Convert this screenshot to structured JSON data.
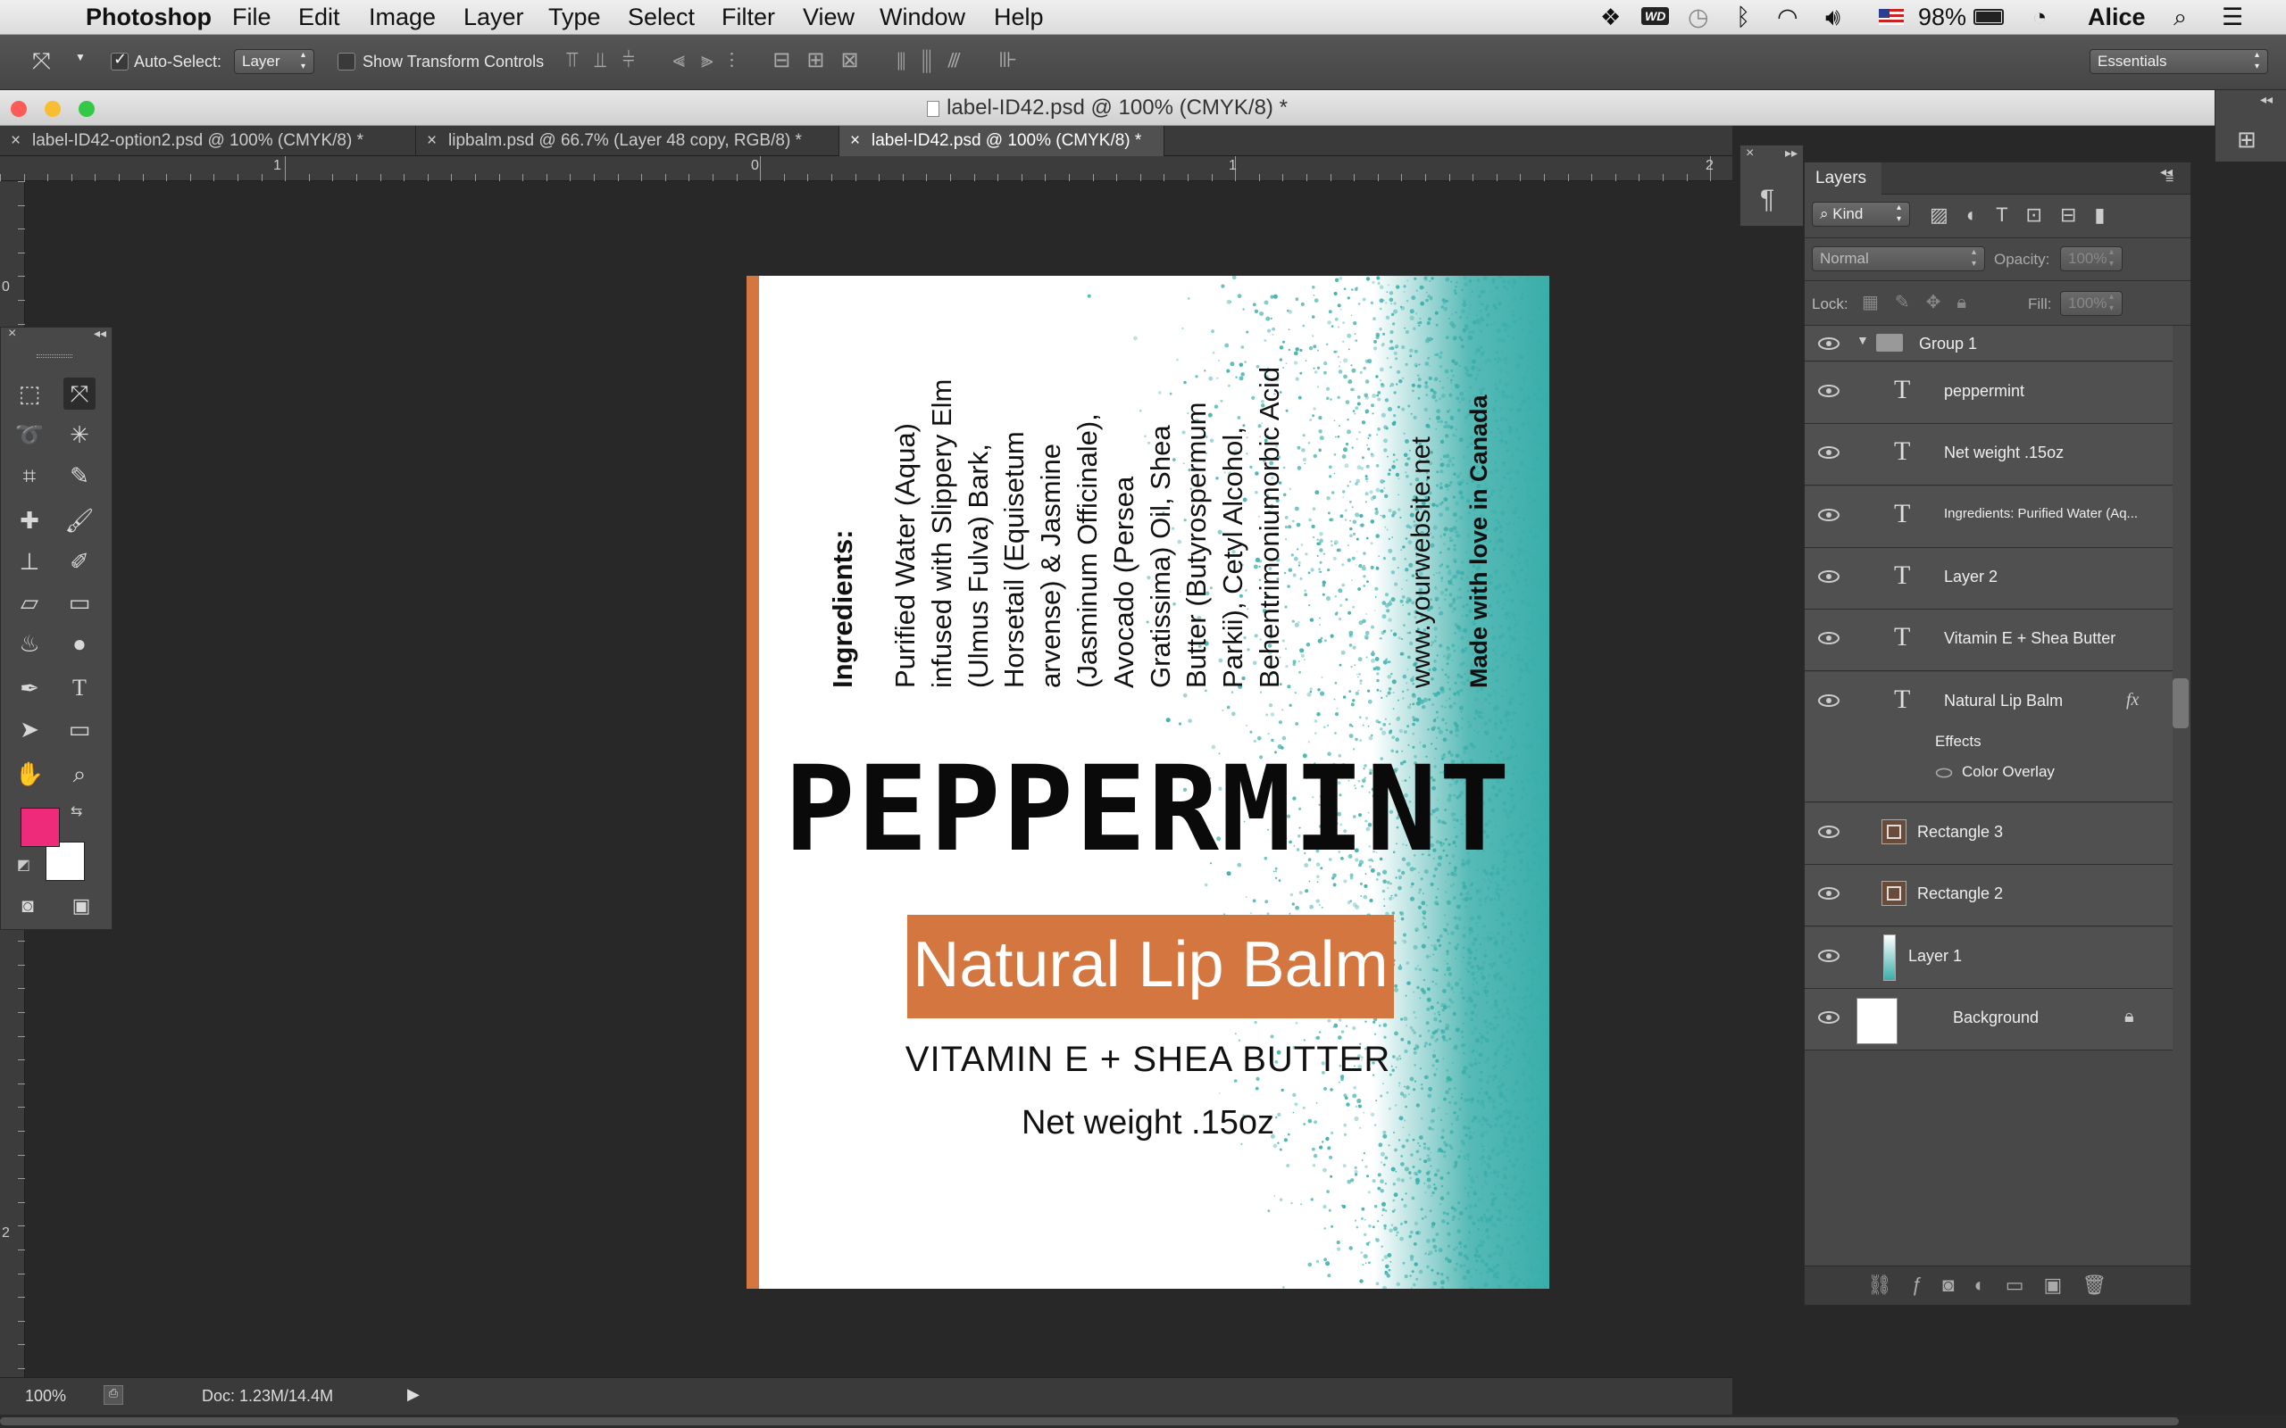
{
  "menubar": {
    "app_name": "Photoshop",
    "items": [
      "File",
      "Edit",
      "Image",
      "Layer",
      "Type",
      "Select",
      "Filter",
      "View",
      "Window",
      "Help"
    ],
    "battery": "98%",
    "user": "Alice",
    "tray_icons": [
      "dropbox-icon",
      "wd-icon",
      "time-machine-icon",
      "bluetooth-icon",
      "wifi-icon",
      "volume-icon",
      "flag-icon",
      "battery-icon",
      "clock-icon",
      "search-icon",
      "list-icon"
    ]
  },
  "options": {
    "auto_select_label": "Auto-Select:",
    "auto_select_value": "Layer",
    "show_transform_label": "Show Transform Controls",
    "workspace": "Essentials"
  },
  "window": {
    "title": "label-ID42.psd @ 100% (CMYK/8) *"
  },
  "tabs": [
    {
      "label": "label-ID42-option2.psd @ 100% (CMYK/8) *",
      "active": false
    },
    {
      "label": "lipbalm.psd @ 66.7% (Layer 48 copy, RGB/8) *",
      "active": false
    },
    {
      "label": "label-ID42.psd @ 100% (CMYK/8) *",
      "active": true
    }
  ],
  "ruler": {
    "h_labels": [
      "1",
      "0",
      "1",
      "2"
    ],
    "v_labels": [
      "0",
      "2"
    ]
  },
  "label": {
    "ingredients_heading": "Ingredients:",
    "ingredients_lines": [
      "Purified Water (Aqua)",
      "infused with Slippery Elm",
      "(Ulmus Fulva) Bark,",
      "Horsetail (Equisetum",
      "arvense) & Jasmine",
      "(Jasminum Officinale),",
      "Avocado (Persea",
      "Gratissima) Oil, Shea",
      "Butter (Butyrospermum",
      "Parkii), Cetyl Alcohol,",
      "Behentrimoniumorbic Acid"
    ],
    "website": "www.yourwebsite.net",
    "made_in": "Made with love in Canada",
    "flavor": "PEPPERMINT",
    "product": "Natural Lip Balm",
    "tagline": "VITAMIN E + SHEA BUTTER",
    "net_weight": "Net weight .15oz",
    "colors": {
      "teal": "#3aaeaa",
      "orange": "#d4763f"
    }
  },
  "layers_panel": {
    "title": "Layers",
    "filter_kind": "Kind",
    "blend_mode": "Normal",
    "opacity_label": "Opacity:",
    "opacity_value": "100%",
    "lock_label": "Lock:",
    "fill_label": "Fill:",
    "fill_value": "100%",
    "group_name": "Group 1",
    "layers": [
      {
        "name": "peppermint",
        "type": "text"
      },
      {
        "name": "Net weight .15oz",
        "type": "text"
      },
      {
        "name": "Ingredients:   Purified Water (Aq...",
        "type": "text"
      },
      {
        "name": "Layer 2",
        "type": "text"
      },
      {
        "name": "Vitamin E + Shea Butter",
        "type": "text"
      },
      {
        "name": "Natural Lip Balm",
        "type": "text",
        "fx": "fx"
      }
    ],
    "effects_label": "Effects",
    "effect_name": "Color Overlay",
    "lower_layers": [
      {
        "name": "Rectangle 3",
        "type": "shape"
      },
      {
        "name": "Rectangle 2",
        "type": "shape"
      },
      {
        "name": "Layer 1",
        "type": "pixel"
      },
      {
        "name": "Background",
        "type": "background"
      }
    ]
  },
  "tools": {
    "foreground": "#ee2b7b",
    "background": "#ffffff"
  },
  "status": {
    "zoom": "100%",
    "doc": "Doc: 1.23M/14.4M"
  }
}
